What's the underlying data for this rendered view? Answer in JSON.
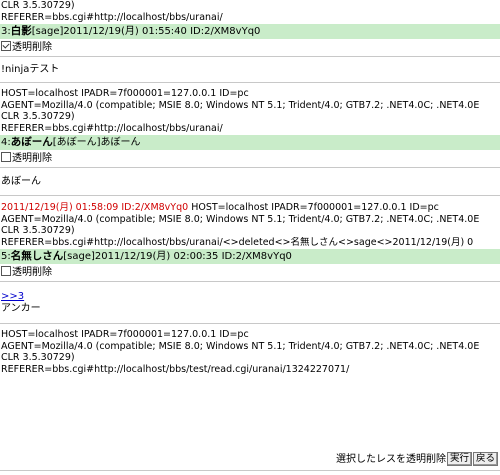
{
  "top": {
    "clr": "CLR 3.5.30729)",
    "referer": "REFERER=bbs.cgi#http://localhost/bbs/uranai/"
  },
  "post3": {
    "number": "3:",
    "name": "白影",
    "mail": "[sage]",
    "date": "2011/12/19(月) 01:55:40 ID:2/XM8vYq0",
    "checkbox_label": "透明削除",
    "body": "!ninjaテスト",
    "host": "HOST=localhost IPADR=7f000001=127.0.0.1 ID=pc",
    "agent": "AGENT=Mozilla/4.0 (compatible; MSIE 8.0; Windows NT 5.1; Trident/4.0; GTB7.2; .NET4.0C; .NET4.0E",
    "clr": "CLR 3.5.30729)",
    "referer": "REFERER=bbs.cgi#http://localhost/bbs/uranai/"
  },
  "post4": {
    "number": "4:",
    "name": "あぼーん",
    "mail": "[あぼーん]",
    "date": "あぼーん",
    "checkbox_label": "透明削除",
    "body": "あぼーん",
    "deleted_info": "2011/12/19(月) 01:58:09 ID:2/XM8vYq0",
    "host": " HOST=localhost IPADR=7f000001=127.0.0.1 ID=pc",
    "agent": "AGENT=Mozilla/4.0 (compatible; MSIE 8.0; Windows NT 5.1; Trident/4.0; GTB7.2; .NET4.0C; .NET4.0E",
    "clr": "CLR 3.5.30729)",
    "referer": "REFERER=bbs.cgi#http://localhost/bbs/uranai/<>deleted<>名無しさん<>sage<>2011/12/19(月) 0"
  },
  "post5": {
    "number": "5:",
    "name": "名無しさん",
    "mail": "[sage]",
    "date": "2011/12/19(月) 02:00:35 ID:2/XM8vYq0",
    "checkbox_label": "透明削除",
    "anchor": ">>3",
    "body": "アンカー",
    "host": "HOST=localhost IPADR=7f000001=127.0.0.1 ID=pc",
    "agent": "AGENT=Mozilla/4.0 (compatible; MSIE 8.0; Windows NT 5.1; Trident/4.0; GTB7.2; .NET4.0C; .NET4.0E",
    "clr": "CLR 3.5.30729)",
    "referer": "REFERER=bbs.cgi#http://localhost/bbs/test/read.cgi/uranai/1324227071/"
  },
  "footer": {
    "label": "選択したレスを透明削除",
    "run_button": "実行",
    "back_button": "戻る"
  }
}
